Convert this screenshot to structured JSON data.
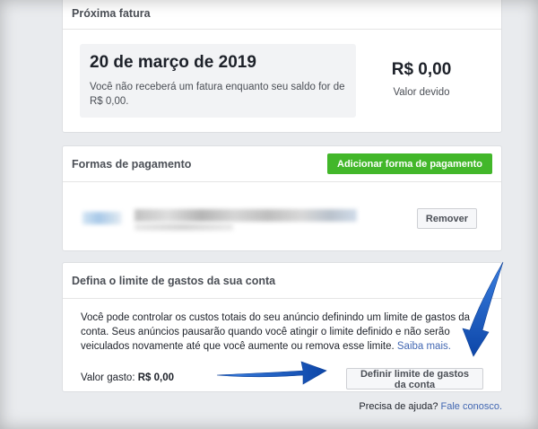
{
  "invoice": {
    "title": "Próxima fatura",
    "date": "20 de março de 2019",
    "note": "Você não receberá um fatura enquanto seu saldo for de R$ 0,00.",
    "amount": "R$ 0,00",
    "amount_label": "Valor devido"
  },
  "payment": {
    "title": "Formas de pagamento",
    "add_button": "Adicionar forma de pagamento",
    "remove_button": "Remover"
  },
  "limit": {
    "title": "Defina o limite de gastos da sua conta",
    "description": "Você pode controlar os custos totais do seu anúncio definindo um limite de gastos da conta. Seus anúncios pausarão quando você atingir o limite definido e não serão veiculados novamente até que você aumente ou remova esse limite.",
    "learn_more": "Saiba mais.",
    "spent_label": "Valor gasto:",
    "spent_value": "R$ 0,00",
    "set_limit_button": "Definir limite de gastos da conta"
  },
  "help": {
    "question": "Precisa de ajuda?",
    "contact": "Fale conosco."
  },
  "colors": {
    "primary_button": "#42b72a",
    "link": "#4267b2",
    "annotation_arrow": "#1f5fc4"
  }
}
